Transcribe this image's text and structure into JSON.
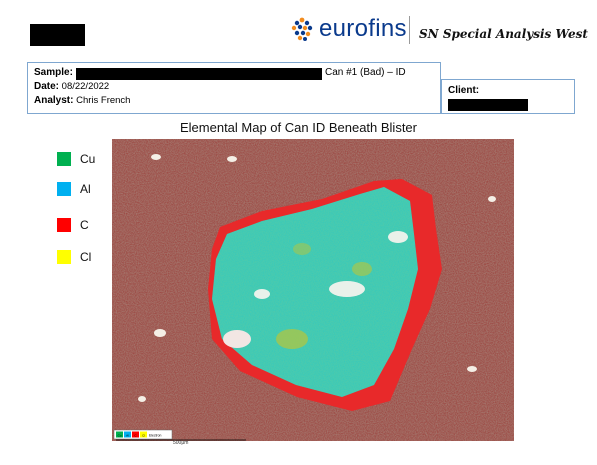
{
  "header": {
    "brand": "eurofins",
    "division": "SN Special Analysis West"
  },
  "info": {
    "sample_label": "Sample:",
    "sample_suffix": "Can #1 (Bad) – ID",
    "date_label": "Date:",
    "date_value": "08/22/2022",
    "analyst_label": "Analyst:",
    "analyst_value": "Chris French",
    "client_label": "Client:"
  },
  "map": {
    "title": "Elemental Map of Can ID Beneath Blister",
    "legend": [
      {
        "label": "Cu",
        "color": "#00b050"
      },
      {
        "label": "Al",
        "color": "#00b0f0"
      },
      {
        "label": "C",
        "color": "#ff0000"
      },
      {
        "label": "Cl",
        "color": "#ffff00"
      }
    ],
    "inset_labels": [
      "Cu",
      "Al",
      "C",
      "Cl",
      "Electron"
    ],
    "scale_text": "500μm"
  }
}
